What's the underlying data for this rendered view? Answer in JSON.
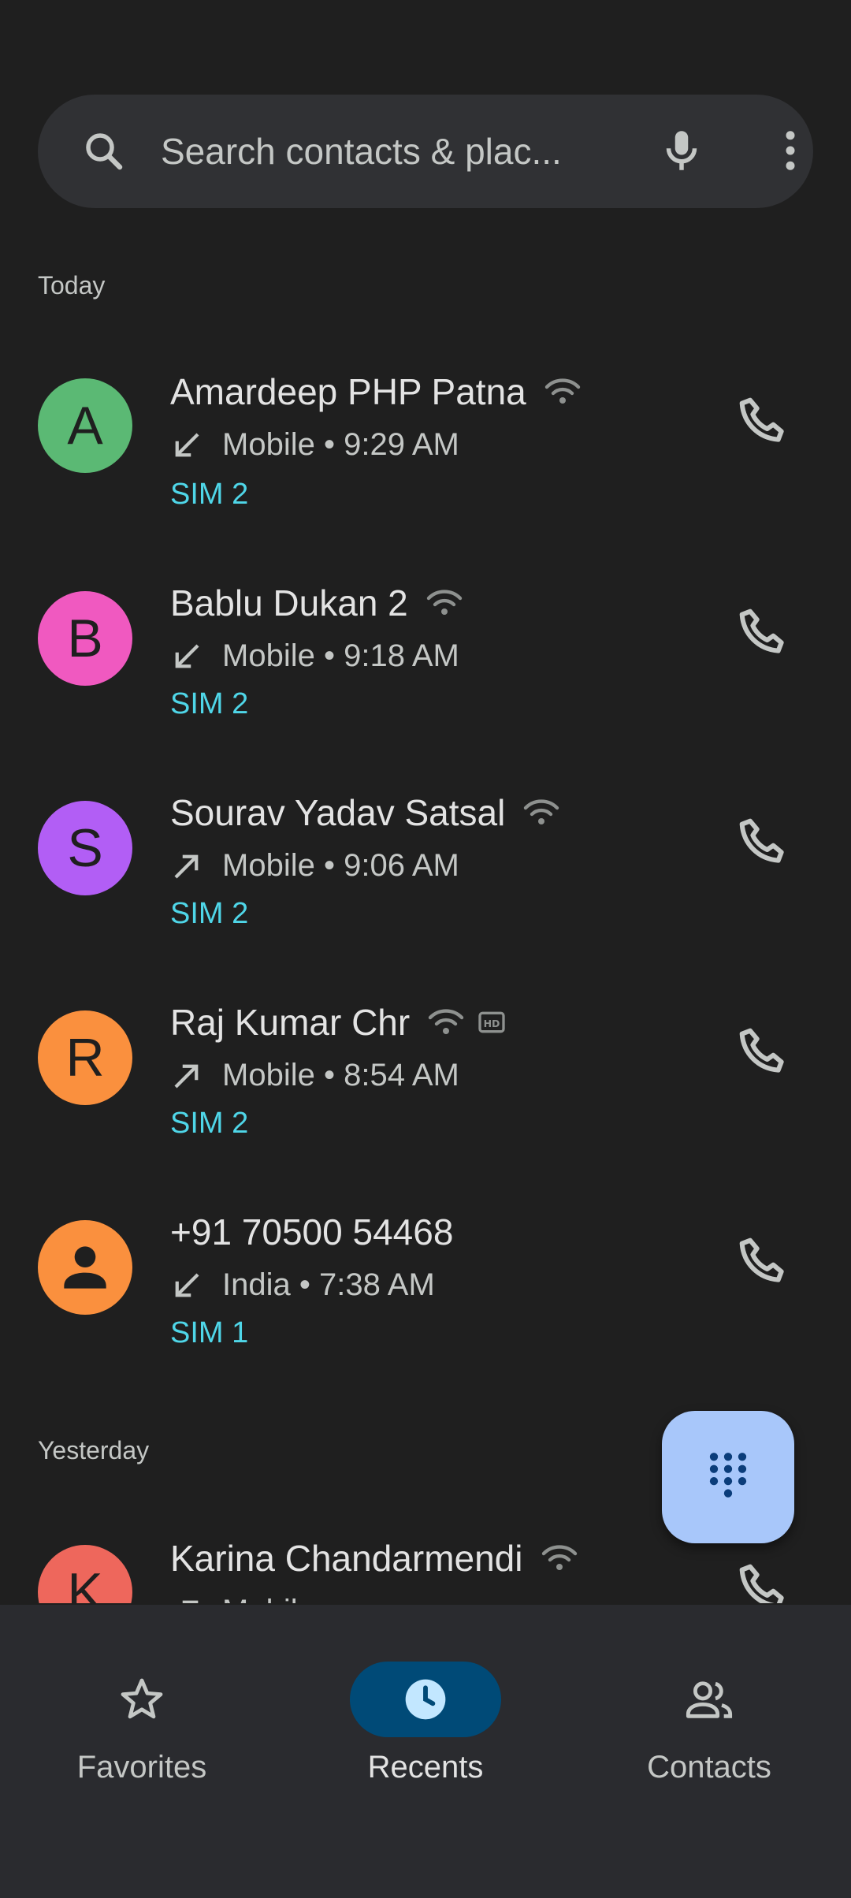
{
  "search": {
    "placeholder": "Search contacts & plac..."
  },
  "sections": {
    "today": "Today",
    "yesterday": "Yesterday"
  },
  "calls": [
    {
      "initial": "A",
      "name": "Amardeep PHP Patna",
      "type": "Mobile",
      "time": "9:29 AM",
      "sim": "SIM 2",
      "direction": "incoming",
      "color": "#5bb974"
    },
    {
      "initial": "B",
      "name": "Bablu Dukan 2",
      "type": "Mobile",
      "time": "9:18 AM",
      "sim": "SIM 2",
      "direction": "incoming",
      "color": "#f059c0"
    },
    {
      "initial": "S",
      "name": "Sourav Yadav Satsal",
      "type": "Mobile",
      "time": "9:06 AM",
      "sim": "SIM 2",
      "direction": "outgoing",
      "color": "#b25ef5"
    },
    {
      "initial": "R",
      "name": "Raj Kumar Chr",
      "type": "Mobile",
      "time": "8:54 AM",
      "sim": "SIM 2",
      "direction": "outgoing",
      "color": "#fa903e",
      "hd": "HD"
    },
    {
      "initial": "",
      "name": "+91 70500 54468",
      "type": "India",
      "time": "7:38 AM",
      "sim": "SIM 1",
      "direction": "incoming",
      "color": "#fa903e"
    },
    {
      "initial": "K",
      "name": "Karina Chandarmendi",
      "type": "Mobile",
      "time": "",
      "sim": "",
      "direction": "outgoing",
      "color": "#ee675c"
    }
  ],
  "nav": {
    "favorites": "Favorites",
    "recents": "Recents",
    "contacts": "Contacts"
  },
  "separator": "•",
  "icons": {
    "search": "search-icon",
    "mic": "mic-icon",
    "more": "more-vert-icon",
    "call": "phone-icon",
    "wifi": "wifi-calling-icon",
    "dialpad": "dialpad-icon",
    "star": "star-icon",
    "clock": "clock-icon",
    "people": "people-icon"
  },
  "colors": {
    "accent_sim": "#4fd6e8",
    "fab": "#a8c7fa",
    "nav_active": "#004a77"
  }
}
